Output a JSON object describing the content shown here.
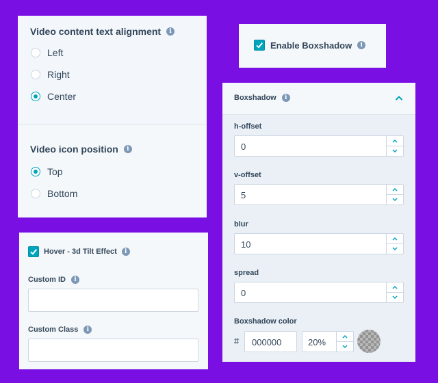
{
  "alignment": {
    "title": "Video content text alignment",
    "options": [
      {
        "label": "Left",
        "selected": false
      },
      {
        "label": "Right",
        "selected": false
      },
      {
        "label": "Center",
        "selected": true
      }
    ]
  },
  "icon_position": {
    "title": "Video icon position",
    "options": [
      {
        "label": "Top",
        "selected": true
      },
      {
        "label": "Bottom",
        "selected": false
      }
    ]
  },
  "enable_boxshadow": {
    "label": "Enable Boxshadow",
    "checked": true
  },
  "boxshadow": {
    "title": "Boxshadow",
    "fields": [
      {
        "label": "h-offset",
        "value": "0"
      },
      {
        "label": "v-offset",
        "value": "5"
      },
      {
        "label": "blur",
        "value": "10"
      },
      {
        "label": "spread",
        "value": "0"
      }
    ],
    "color": {
      "label": "Boxshadow color",
      "hash": "#",
      "hex": "000000",
      "opacity": "20%"
    }
  },
  "hover": {
    "checkbox_label": "Hover - 3d Tilt Effect",
    "checked": true,
    "custom_id_label": "Custom ID",
    "custom_id_value": "",
    "custom_class_label": "Custom Class",
    "custom_class_value": ""
  },
  "colors": {
    "accent": "#00a4bd",
    "background": "#7a0fe3",
    "text": "#33475b",
    "info": "#7c98b6"
  }
}
